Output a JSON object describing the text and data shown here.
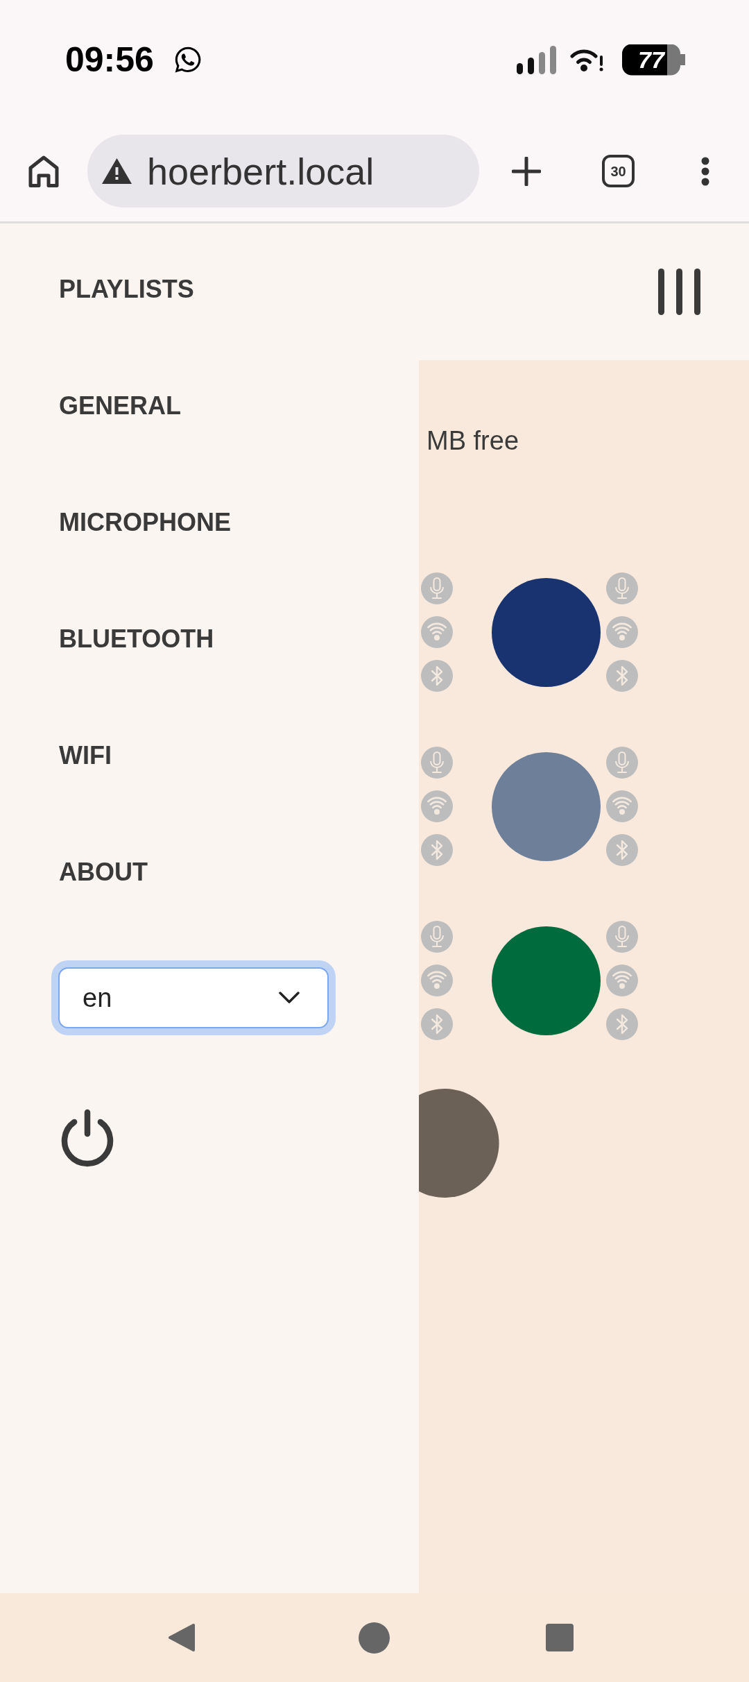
{
  "status_bar": {
    "time": "09:56",
    "battery": "77"
  },
  "browser": {
    "url": "hoerbert.local",
    "tab_count": "30"
  },
  "page": {
    "storage_text": "MB free",
    "button_rows": [
      {
        "color": "#183370"
      },
      {
        "color": "#6e8099"
      },
      {
        "color": "#006b3c"
      }
    ],
    "cut_off_button": {
      "color": "#6b6157"
    }
  },
  "drawer": {
    "items": [
      {
        "label": "PLAYLISTS"
      },
      {
        "label": "GENERAL"
      },
      {
        "label": "MICROPHONE"
      },
      {
        "label": "BLUETOOTH"
      },
      {
        "label": "WIFI"
      },
      {
        "label": "ABOUT"
      }
    ],
    "language_select": {
      "value": "en",
      "focused": true
    }
  }
}
